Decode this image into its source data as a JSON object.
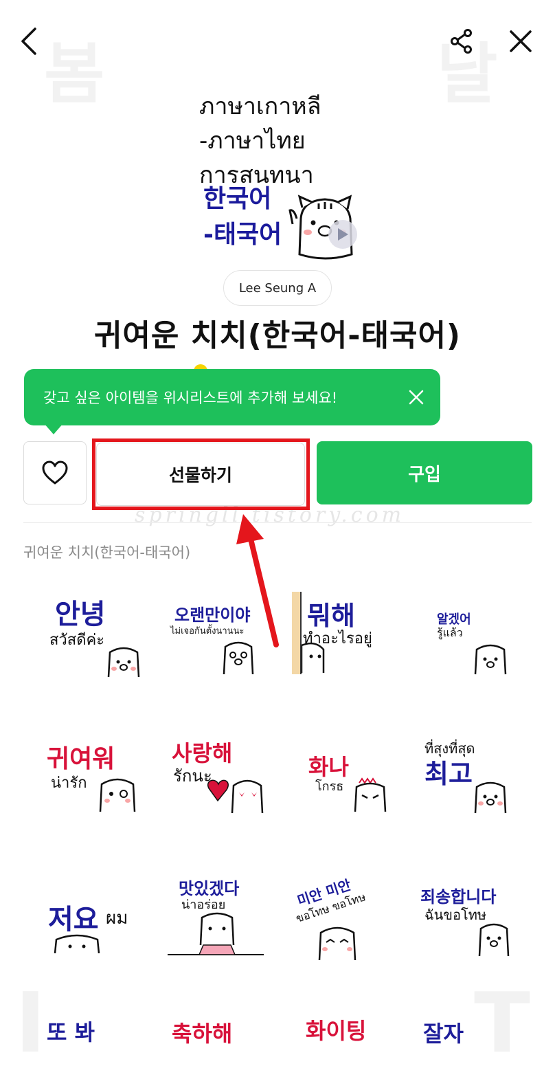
{
  "header": {
    "back_icon": "chevron-left-icon",
    "share_icon": "share-icon",
    "close_icon": "close-icon"
  },
  "main_image": {
    "thai_lines": [
      "ภาษาเกาหลี",
      "-ภาษาไทย",
      "การสนทนา"
    ],
    "korean_lines": [
      "한국어",
      "-태국어"
    ],
    "play_icon": "play-icon"
  },
  "author": "Lee Seung A",
  "title": "귀여운 치치(한국어-태국어)",
  "tooltip": {
    "text": "갖고 싶은 아이템을 위시리스트에 추가해 보세요!",
    "close_icon": "close-icon"
  },
  "actions": {
    "wishlist_icon": "heart-icon",
    "gift_label": "선물하기",
    "buy_label": "구입"
  },
  "watermark": "springll.tistory.com",
  "section_label": "귀여운 치치(한국어-태국어)",
  "stickers": [
    {
      "ko": "안녕",
      "th": "สวัสดีค่ะ"
    },
    {
      "ko": "오랜만이야",
      "th": "ไม่เจอกันตั้งนานนะ"
    },
    {
      "ko": "뭐해",
      "th": "ทำอะไรอยู่"
    },
    {
      "ko": "알겠어",
      "th": "รู้แล้ว"
    },
    {
      "ko": "귀여워",
      "th": "น่ารัก"
    },
    {
      "ko": "사랑해",
      "th": "รักนะ"
    },
    {
      "ko": "화나",
      "th": "โกรธ"
    },
    {
      "ko": "최고",
      "th": "ที่สุงที่สุด"
    },
    {
      "ko": "저요",
      "th": "ผม"
    },
    {
      "ko": "맛있겠다",
      "th": "น่าอร่อย"
    },
    {
      "ko": "미안 미안",
      "th": "ขอโทษ ขอโทษ"
    },
    {
      "ko": "죄송합니다",
      "th": "ฉันขอโทษ"
    },
    {
      "ko": "또 봐",
      "th": ""
    },
    {
      "ko": "축하해",
      "th": ""
    },
    {
      "ko": "화이팅",
      "th": ""
    },
    {
      "ko": "잘자",
      "th": ""
    }
  ],
  "colors": {
    "brand_green": "#1ec05b",
    "highlight_red": "#e4161c",
    "sticker_navy": "#1d1d9a",
    "sticker_red": "#d8123a"
  }
}
